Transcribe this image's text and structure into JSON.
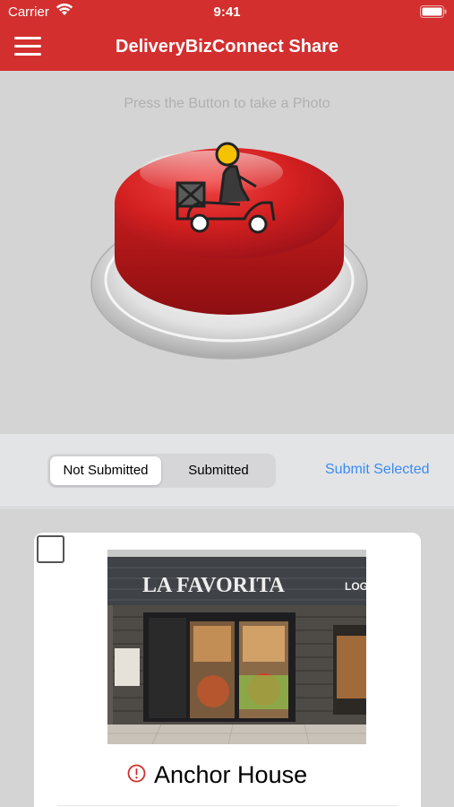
{
  "status_bar": {
    "carrier": "Carrier",
    "time": "9:41"
  },
  "nav": {
    "title": "DeliveryBizConnect Share",
    "menu_icon": "hamburger-icon"
  },
  "capture": {
    "hint": "Press the Button to take a Photo",
    "button_icon": "delivery-scooter-icon"
  },
  "segments": {
    "not_submitted": "Not Submitted",
    "submitted": "Submitted",
    "selected": "Not Submitted"
  },
  "actions": {
    "submit_selected": "Submit Selected"
  },
  "cards": [
    {
      "title": "Anchor House",
      "photo_sign": "LA FAVORITA",
      "photo_side_sign": "LOG",
      "status_icon": "warning-circle-icon",
      "checked": false
    }
  ],
  "colors": {
    "brand_red": "#d32f2f",
    "link_blue": "#3b8cf0"
  }
}
